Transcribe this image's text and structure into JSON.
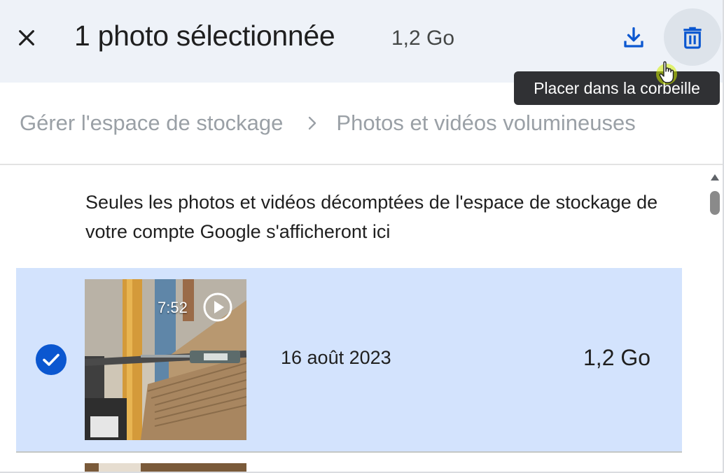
{
  "header": {
    "close_icon": "close-icon",
    "title": "1 photo sélectionnée",
    "size": "1,2 Go",
    "download_icon": "download-icon",
    "trash_icon": "trash-icon",
    "tooltip": "Placer dans la corbeille"
  },
  "breadcrumb": {
    "items": [
      "Gérer l'espace de stockage",
      "Photos et vidéos volumineuses"
    ],
    "separator_icon": "chevron-right-icon"
  },
  "info_text": "Seules les photos et vidéos décomptées de l'espace de stockage de votre compte Google s'afficheront ici",
  "items": [
    {
      "selected": true,
      "duration": "7:52",
      "date": "16 août 2023",
      "size": "1,2 Go"
    }
  ],
  "colors": {
    "accent": "#0b57d0",
    "topbar_bg": "#eef2f8",
    "selected_row_bg": "#d3e3fd",
    "tooltip_bg": "#303134"
  }
}
